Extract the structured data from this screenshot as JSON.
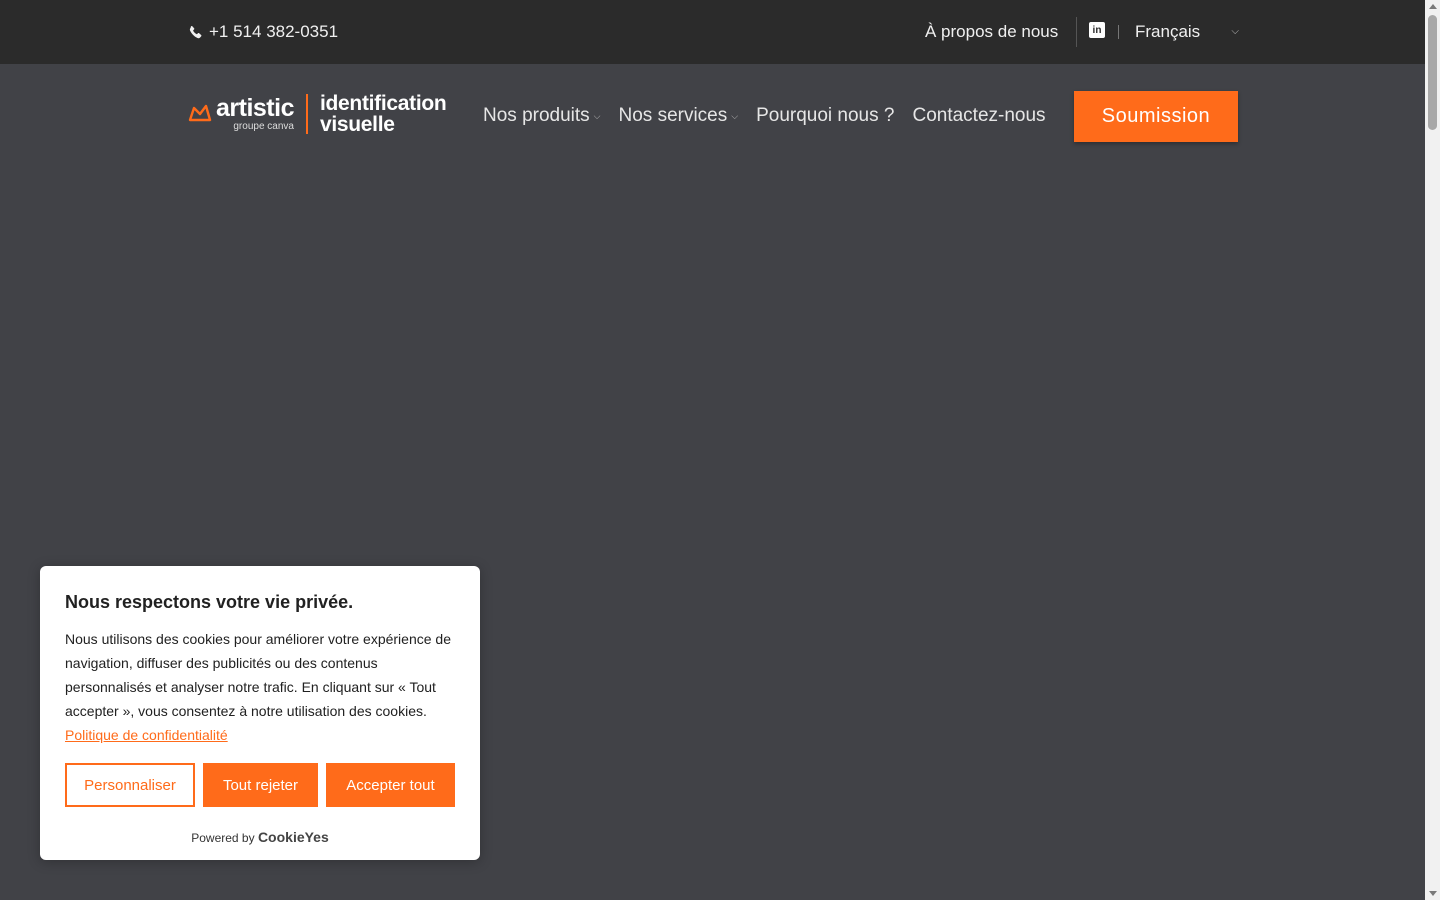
{
  "topbar": {
    "phone": "+1 514 382-0351",
    "about_link": "À propos de nous",
    "linkedin_icon": "linkedin-icon",
    "language": "Français"
  },
  "header": {
    "logo": {
      "brand": "artistic",
      "sub": "groupe canva",
      "tagline_1": "identification",
      "tagline_2": "visuelle"
    },
    "nav": [
      {
        "label": "Nos produits",
        "dropdown": true
      },
      {
        "label": "Nos services",
        "dropdown": true
      },
      {
        "label": "Pourquoi nous ?",
        "dropdown": false
      },
      {
        "label": "Contactez-nous",
        "dropdown": false
      }
    ],
    "cta_label": "Soumission"
  },
  "cookie": {
    "title": "Nous respectons votre vie privée.",
    "text": "Nous utilisons des cookies pour améliorer votre expérience de navigation, diffuser des publicités ou des contenus personnalisés et analyser notre trafic. En cliquant sur « Tout accepter », vous consentez à notre utilisation des cookies.",
    "policy_link": "Politique de confidentialité",
    "buttons": {
      "customize": "Personnaliser",
      "reject": "Tout rejeter",
      "accept": "Accepter tout"
    },
    "powered_by": "Powered by",
    "powered_brand": "CookieYes"
  },
  "colors": {
    "accent": "#ff6b1a",
    "topbar_bg": "#2b2b2b",
    "page_bg": "#414247"
  }
}
